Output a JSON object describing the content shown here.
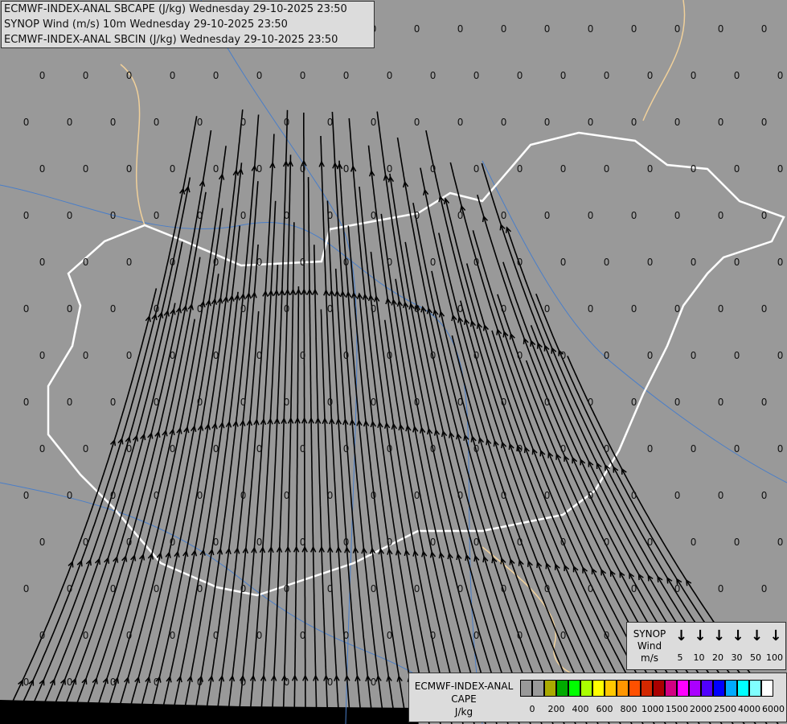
{
  "title_lines": [
    "ECMWF-INDEX-ANAL SBCAPE (J/kg) Wednesday 29-10-2025 23:50",
    "SYNOP Wind (m/s) 10m Wednesday 29-10-2025 23:50",
    "ECMWF-INDEX-ANAL SBCIN (J/kg) Wednesday 29-10-2025 23:50"
  ],
  "station_value": "0",
  "wind_legend": {
    "line1": "SYNOP",
    "line2": "Wind",
    "line3": "m/s",
    "speeds": [
      "5",
      "10",
      "20",
      "30",
      "50",
      "100"
    ]
  },
  "cape_legend": {
    "line1": "ECMWF-INDEX-ANAL",
    "line2": "CAPE",
    "line3": "J/kg",
    "colors": [
      "#999999",
      "#999999",
      "#aaaa00",
      "#00aa00",
      "#00ff00",
      "#aaff00",
      "#ffff00",
      "#ffc800",
      "#ff9600",
      "#ff5000",
      "#d22800",
      "#aa0000",
      "#d20082",
      "#ff00ff",
      "#aa00ff",
      "#5000ff",
      "#0000ff",
      "#00aaff",
      "#00ffff",
      "#80ffff",
      "#ffffff"
    ],
    "labels": [
      "0",
      "200",
      "400",
      "600",
      "800",
      "1000",
      "1500",
      "2000",
      "2500",
      "4000",
      "6000"
    ]
  },
  "colors": {
    "background": "#999999",
    "country_border": "#ffffff",
    "border": "#f0d09a",
    "river": "#4a7ec8",
    "streamline": "#000000"
  }
}
